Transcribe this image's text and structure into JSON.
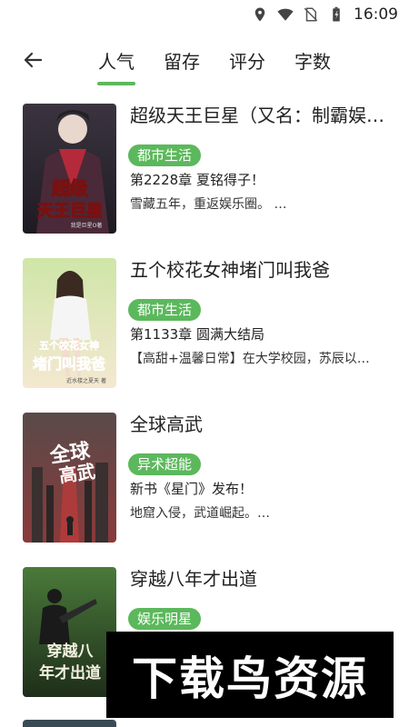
{
  "status_bar": {
    "time": "16:09",
    "icons": [
      "location-icon",
      "wifi-icon",
      "no-sim-icon",
      "battery-icon"
    ]
  },
  "header": {
    "back_icon": "arrow-left-icon",
    "tabs": [
      {
        "label": "人气",
        "active": true
      },
      {
        "label": "留存",
        "active": false
      },
      {
        "label": "评分",
        "active": false
      },
      {
        "label": "字数",
        "active": false
      }
    ]
  },
  "books": [
    {
      "title": "超级天王巨星（又名：制霸娱…",
      "tag": "都市生活",
      "chapter": "第2228章 夏铭得子！",
      "intro": "雪藏五年，重返娱乐圈。 …",
      "cover_text": "超级天王巨星",
      "cover_author": "我是巨星O著"
    },
    {
      "title": "五个校花女神堵门叫我爸",
      "tag": "都市生活",
      "chapter": "第1133章 圆满大结局",
      "intro": "【高甜+温馨日常】在大学校园，苏辰以…",
      "cover_text": "五个校花女神堵门叫我爸",
      "cover_author": "近水楼之夏天 著"
    },
    {
      "title": "全球高武",
      "tag": "异术超能",
      "chapter": "新书《星门》发布！",
      "intro": "地窟入侵，武道崛起。…",
      "cover_text": "全球高武"
    },
    {
      "title": "穿越八年才出道",
      "tag": "娱乐明星",
      "chapter": "",
      "intro": "",
      "cover_text": "穿越八年才出道"
    }
  ],
  "watermark": "下载鸟资源",
  "colors": {
    "accent": "#5cb85c"
  }
}
